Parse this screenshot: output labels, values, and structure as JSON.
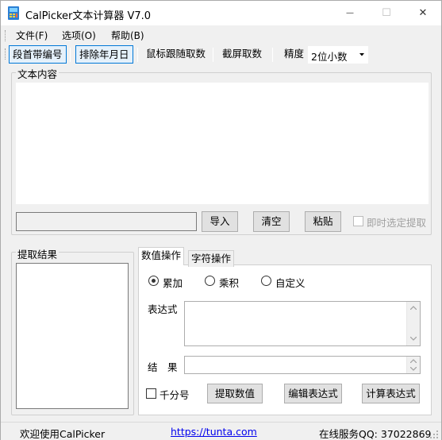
{
  "window": {
    "title": "CalPicker文本计算器 V7.0",
    "minimize_glyph": "—",
    "maximize_glyph": "☐",
    "close_glyph": "✕"
  },
  "menu": [
    "文件(F)",
    "选项(O)",
    "帮助(B)"
  ],
  "toolbar": {
    "para_prefix_label": "段首带编号",
    "exclude_date_label": "排除年月日",
    "mouse_follow_label": "鼠标跟随取数",
    "screenshot_label": "截屏取数",
    "precision_label": "精度",
    "precision_value": "2位小数"
  },
  "text_group": {
    "title": "文本内容",
    "text_value": "",
    "path_value": "",
    "import_label": "导入",
    "clear_label": "清空",
    "paste_label": "粘贴",
    "auto_extract_label": "即时选定提取",
    "auto_extract_checked": false
  },
  "result_group": {
    "title": "提取结果",
    "items": []
  },
  "tabs": {
    "numeric_label": "数值操作",
    "string_label": "字符操作",
    "active": "numeric"
  },
  "numeric_panel": {
    "radios": [
      "累加",
      "乘积",
      "自定义"
    ],
    "selected_radio": "累加",
    "expression_label": "表达式",
    "expression_value": "",
    "result_label": "结　果",
    "result_value": "",
    "thousands_label": "千分号",
    "thousands_checked": false,
    "extract_label": "提取数值",
    "edit_expr_label": "编辑表达式",
    "calc_expr_label": "计算表达式"
  },
  "status": {
    "welcome": "欢迎使用CalPicker",
    "link": "https://tunta.com",
    "service": "在线服务QQ: 37022869"
  },
  "colors": {
    "accent": "#0078d7",
    "window_bg": "#f0f0f0",
    "link": "#0000ee"
  }
}
